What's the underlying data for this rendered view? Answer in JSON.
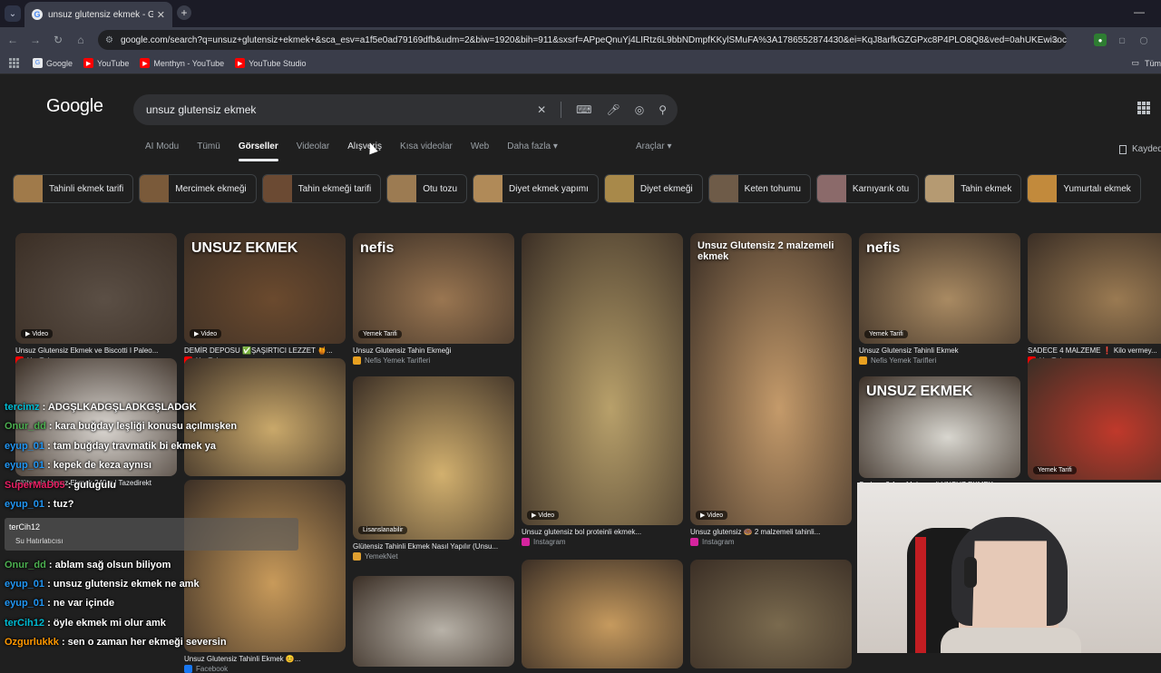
{
  "browser": {
    "tab_title": "unsuz glutensiz ekmek - Google",
    "url": "google.com/search?q=unsuz+glutensiz+ekmek+&sca_esv=a1f5e0ad79169dfb&udm=2&biw=1920&bih=911&sxsrf=APpeQnuYj4LIRtz6L9bbNDmpfKKylSMuFA%3A1786552874430&ei=KqJ8arfkGZGPxc8P4PLO8Q8&ved=0ahUKEwi3oc...",
    "bookmarks": [
      "Google",
      "YouTube",
      "Menthyn - YouTube",
      "YouTube Studio"
    ],
    "all_bookmarks": "Tüm"
  },
  "google": {
    "logo": "Google",
    "query": "unsuz glutensiz ekmek",
    "tabs": [
      "AI Modu",
      "Tümü",
      "Görseller",
      "Videolar",
      "Alışveriş",
      "Kısa videolar",
      "Web",
      "Daha fazla ▾"
    ],
    "tools": "Araçlar ▾",
    "saved": "Kaydedi",
    "chips": [
      "Tahinli ekmek tarifi",
      "Mercimek ekmeği",
      "Tahin ekmeği tarifi",
      "Otu tozu",
      "Diyet ekmek yapımı",
      "Diyet ekmeği",
      "Keten tohumu",
      "Karnıyarık otu",
      "Tahin ekmek",
      "Yumurtalı ekmek"
    ],
    "chip_colors": [
      "#a07a4a",
      "#7a5a3a",
      "#6b4a33",
      "#9c7b52",
      "#b08a58",
      "#a8894a",
      "#6e5b48",
      "#8b6a6a",
      "#b59a72",
      "#c28a3c"
    ]
  },
  "results": [
    {
      "title": "Unsuz Glutensiz Ekmek ve Biscotti I Paleo...",
      "source": "YouTube",
      "badge": "Video",
      "color": "#5b4f45",
      "src_color": "#ff0000"
    },
    {
      "title": "DEMİR DEPOSU ✅ŞAŞIRTICI LEZZET 🍯...",
      "source": "YouTube",
      "badge": "Video",
      "overlay": "UNSUZ EKMEK",
      "color": "#6b4a2e",
      "src_color": "#ff0000"
    },
    {
      "title": "Unsuz Glutensiz Tahin Ekmeği",
      "source": "Nefis Yemek Tarifleri",
      "badge": "Yemek Tarifi",
      "overlay": "nefis",
      "color": "#9a7651",
      "src_color": "#e8a020"
    },
    {
      "title": "Unsuz glutensiz bol proteinli ekmek...",
      "source": "Instagram",
      "badge": "Video",
      "color": "#b8a06a",
      "src_color": "#d6249f"
    },
    {
      "title": "Unsuz glutensiz 🍩 2 malzemeli tahinli...",
      "source": "Instagram",
      "badge": "Video",
      "overlay": "Unsuz Glutensiz 2 malzemeli ekmek",
      "color": "#c49a6a",
      "src_color": "#d6249f"
    },
    {
      "title": "Unsuz Glutensiz Tahinli Ekmek",
      "source": "Nefis Yemek Tarifleri",
      "badge": "Yemek Tarifi",
      "overlay": "nefis",
      "color": "#a98a62",
      "src_color": "#e8a020"
    },
    {
      "title": "SADECE 4 MALZEME ❗ Kilo vermey...",
      "source": "YouTube",
      "color": "#9a7a52",
      "src_color": "#ff0000"
    },
    {
      "title": "Glütensiz Unsuz Ekmek 240 g | Tazedirekt",
      "source": "",
      "color": "#d9d5d0",
      "src_color": "#777"
    },
    {
      "title": "",
      "source": "",
      "color": "#c9a86a",
      "src_color": "#777"
    },
    {
      "title": "Glütensiz Tahinli Ekmek Nasıl Yapılır (Unsu...",
      "source": "YemekNet",
      "badge": "Lisanslanabilir",
      "color": "#d2b06e",
      "src_color": "#e0a030"
    },
    {
      "title": "Sadece 2 Ana Malzemeli UNSUZ EKMEK",
      "source": "",
      "badge": "",
      "overlay": "UNSUZ EKMEK",
      "color": "#d8d6cf",
      "src_color": "#777"
    },
    {
      "title": "",
      "source": "",
      "badge": "Yemek Tarifi",
      "color": "#c0392b",
      "src_color": "#777"
    },
    {
      "title": "Unsuz Glutensiz Tahinli Ekmek 😊...",
      "source": "Facebook",
      "color": "#c89a5a",
      "src_color": "#1877f2"
    },
    {
      "title": "",
      "source": "",
      "color": "#c69a5e",
      "src_color": "#777"
    },
    {
      "title": "",
      "source": "",
      "color": "#7a6a4e",
      "src_color": "#777"
    },
    {
      "title": "",
      "source": "",
      "color": "#b8b2a8",
      "src_color": "#777"
    }
  ],
  "chat": [
    {
      "user": "tercimz",
      "text": ": ADGŞLKADGŞLADKGŞLADGK",
      "color": "#00bcd4"
    },
    {
      "user": "Onur_dd",
      "text": ": kara buğday leşliği konusu açılmışken",
      "color": "#4caf50"
    },
    {
      "user": "eyup_01",
      "text": ": tam buğday travmatik bi ekmek ya",
      "color": "#2196f3"
    },
    {
      "user": "eyup_01",
      "text": ": kepek de keza aynısı",
      "color": "#2196f3"
    },
    {
      "user": "SuperMaD05",
      "text": ": gulugulu",
      "color": "#e91e63"
    },
    {
      "user": "eyup_01",
      "text": ": tuz?",
      "color": "#2196f3"
    },
    {
      "user": "Onur_dd",
      "text": ": ablam sağ olsun biliyom",
      "color": "#4caf50"
    },
    {
      "user": "eyup_01",
      "text": ": unsuz glutensiz ekmek ne amk",
      "color": "#2196f3"
    },
    {
      "user": "eyup_01",
      "text": ": ne var içinde",
      "color": "#2196f3"
    },
    {
      "user": "terCih12",
      "text": ": öyle ekmek mi olur amk",
      "color": "#00bcd4"
    },
    {
      "user": "Ozgurlukkk",
      "text": ": sen o zaman her ekmeği seversin",
      "color": "#ff9800"
    }
  ],
  "reminder": {
    "name": "terCih12",
    "sub": "Su Hatırlatıcısı"
  }
}
